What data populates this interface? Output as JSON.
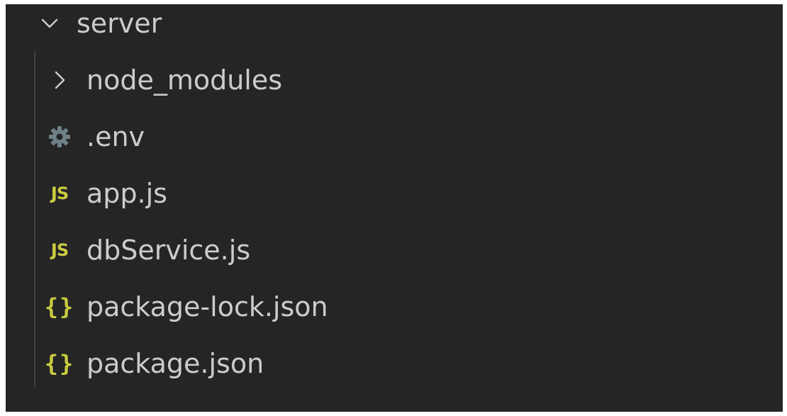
{
  "explorer": {
    "folder": {
      "name": "server",
      "expanded": true,
      "icon": "chevron-down-icon"
    },
    "items": [
      {
        "name": "node_modules",
        "type": "folder",
        "icon": "chevron-right-icon"
      },
      {
        "name": ".env",
        "type": "env",
        "icon": "gear-icon",
        "icon_text": ""
      },
      {
        "name": "app.js",
        "type": "js",
        "icon": "js-file-icon",
        "icon_text": "JS"
      },
      {
        "name": "dbService.js",
        "type": "js",
        "icon": "js-file-icon",
        "icon_text": "JS"
      },
      {
        "name": "package-lock.json",
        "type": "json",
        "icon": "json-file-icon",
        "icon_text": "{}"
      },
      {
        "name": "package.json",
        "type": "json",
        "icon": "json-file-icon",
        "icon_text": "{}"
      }
    ]
  },
  "colors": {
    "background": "#252526",
    "text": "#cccccc",
    "js_icon": "#cbcb41",
    "json_icon": "#cbcb41",
    "gear_icon": "#6d8086",
    "indent_guide": "#404040"
  }
}
